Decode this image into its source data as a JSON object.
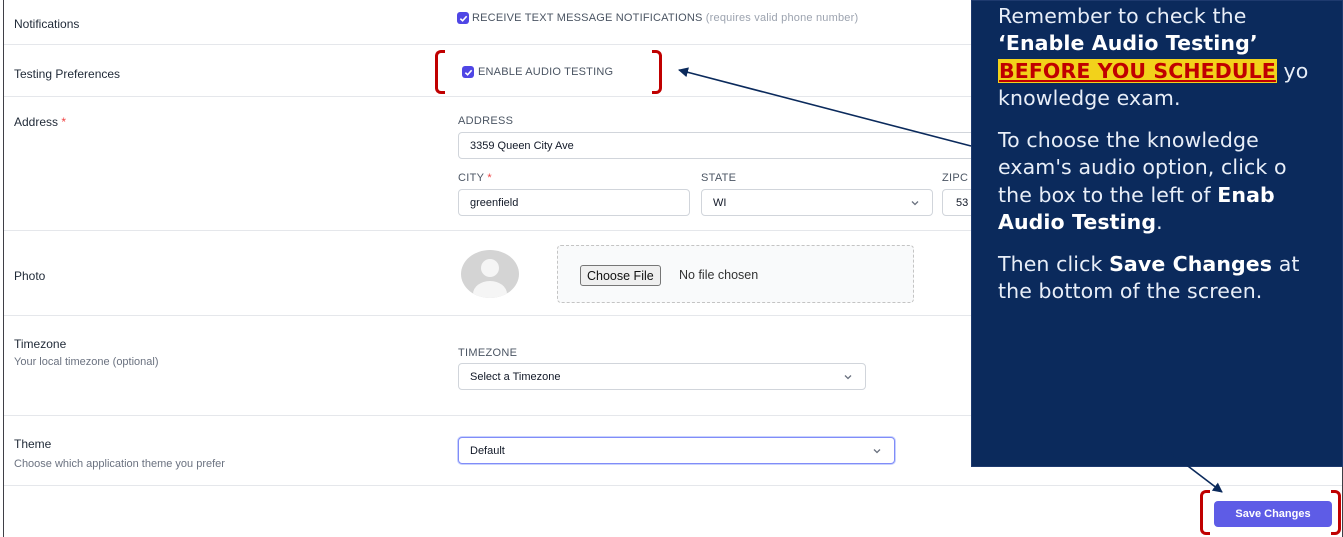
{
  "notifications": {
    "label": "Notifications",
    "checkbox_label": "RECEIVE TEXT MESSAGE NOTIFICATIONS",
    "checkbox_hint": "(requires valid phone number)",
    "checked": true
  },
  "testing": {
    "label": "Testing Preferences",
    "checkbox_label": "ENABLE AUDIO TESTING",
    "checked": true
  },
  "address": {
    "label": "Address",
    "required_mark": "*",
    "address_label": "ADDRESS",
    "address_value": "3359 Queen City Ave",
    "city_label": "CITY",
    "city_value": "greenfield",
    "state_label": "STATE",
    "state_value": "WI",
    "zip_label": "ZIPC",
    "zip_value": "53"
  },
  "photo": {
    "label": "Photo",
    "choose_file": "Choose File",
    "no_file": "No file chosen"
  },
  "timezone": {
    "label": "Timezone",
    "sublabel": "Your local timezone (optional)",
    "field_label": "TIMEZONE",
    "value": "Select a Timezone"
  },
  "theme": {
    "label": "Theme",
    "sublabel": "Choose which application theme you prefer",
    "value": "Default"
  },
  "save_button": "Save Changes",
  "callout": {
    "p1_a": "Remember to check the",
    "p1_b": "‘Enable Audio Testing’",
    "p1_c": "BEFORE YOU SCHEDULE",
    "p1_d": " yo",
    "p1_e": "knowledge exam.",
    "p2_a": "To choose the knowledge",
    "p2_b": "exam's audio option, click o",
    "p2_c": "the box to the left of ",
    "p2_d": "Enab",
    "p2_e": "Audio Testing",
    "p2_f": ".",
    "p3_a": "Then click ",
    "p3_b": "Save Changes",
    "p3_c": " at",
    "p3_d": "the bottom of the screen."
  },
  "colors": {
    "accent": "#5e5ce6",
    "checkbox": "#4f46e5",
    "callout_bg": "#0b2a5c",
    "highlight": "#f2d21b",
    "bracket": "#c00000"
  }
}
